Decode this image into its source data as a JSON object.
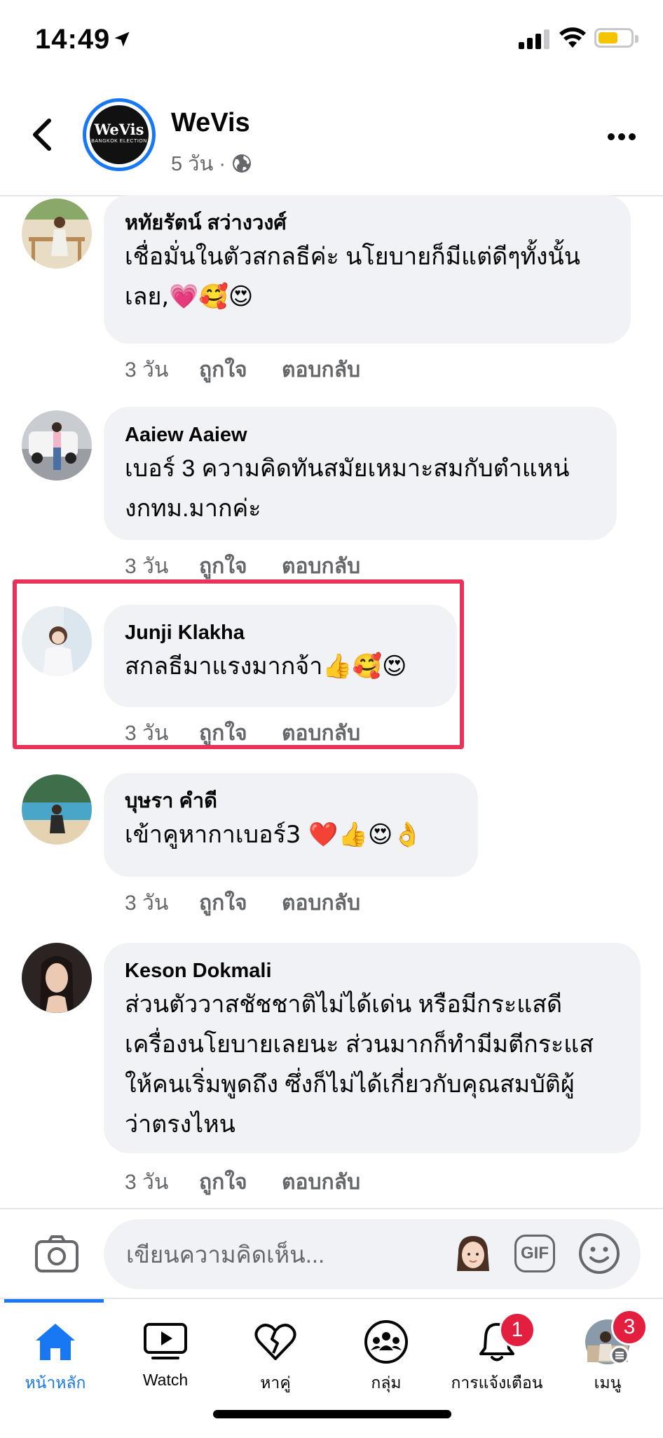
{
  "status_bar": {
    "time": "14:49",
    "battery_level": 0.62,
    "accent_color": "#f5c400"
  },
  "header": {
    "page_name": "WeVis",
    "avatar_logo": "WeVis",
    "avatar_subtitle": "BANGKOK ELECTION",
    "post_age": "5 วัน ·",
    "icons": {
      "back": "back-arrow-icon",
      "privacy": "globe-icon",
      "more": "more-options-icon"
    }
  },
  "comments": [
    {
      "author": "หทัยรัตน์ สว่างวงศ์",
      "lines": [
        "เชื่อมั่นในตัวสกลธีค่ะ นโยบายก็มีแต่ดีๆทั้งนั้น",
        "เลย,💗🥰😍"
      ],
      "time": "3 วัน",
      "like": "ถูกใจ",
      "reply": "ตอบกลับ"
    },
    {
      "author": "Aaiew Aaiew",
      "lines": [
        "เบอร์ 3 ความคิดทันสมัยเหมาะสมกับตำแหน่",
        "งกทม.มากค่ะ"
      ],
      "time": "3 วัน",
      "like": "ถูกใจ",
      "reply": "ตอบกลับ"
    },
    {
      "author": "Junji Klakha",
      "lines": [
        "สกลธีมาแรงมากจ้า👍🥰😍"
      ],
      "time": "3 วัน",
      "like": "ถูกใจ",
      "reply": "ตอบกลับ",
      "highlighted": true
    },
    {
      "author": "บุษรา คำดี",
      "lines": [
        "เข้าคูหากาเบอร์3 ❤️👍😍👌"
      ],
      "time": "3 วัน",
      "like": "ถูกใจ",
      "reply": "ตอบกลับ"
    },
    {
      "author": "Keson Dokmali",
      "lines": [
        "ส่วนตัววาสชัชชาติไม่ได้เด่น หรือมีกระแสดี",
        "เครื่องนโยบายเลยนะ ส่วนมากก็ทำมีมตีกระแส",
        "ให้คนเริ่มพูดถึง ซึ่งก็ไม่ได้เกี่ยวกับคุณสมบัติผู้",
        "ว่าตรงไหน"
      ],
      "time": "3 วัน",
      "like": "ถูกใจ",
      "reply": "ตอบกลับ"
    }
  ],
  "composer": {
    "placeholder": "เขียนความคิดเห็น...",
    "gif_label": "GIF"
  },
  "tabs": [
    {
      "label": "หน้าหลัก",
      "icon": "home-icon",
      "active": true
    },
    {
      "label": "Watch",
      "icon": "watch-icon"
    },
    {
      "label": "หาคู่",
      "icon": "dating-heart-icon"
    },
    {
      "label": "กลุ่ม",
      "icon": "groups-icon"
    },
    {
      "label": "การแจ้งเตือน",
      "icon": "bell-icon",
      "badge": "1"
    },
    {
      "label": "เมนู",
      "icon": "menu-avatar-icon",
      "badge": "3"
    }
  ],
  "colors": {
    "brand": "#1877f2",
    "badge": "#e41e3f",
    "highlight_box": "#e8345a",
    "bubble": "#f0f2f5",
    "secondary_text": "#65676b"
  }
}
